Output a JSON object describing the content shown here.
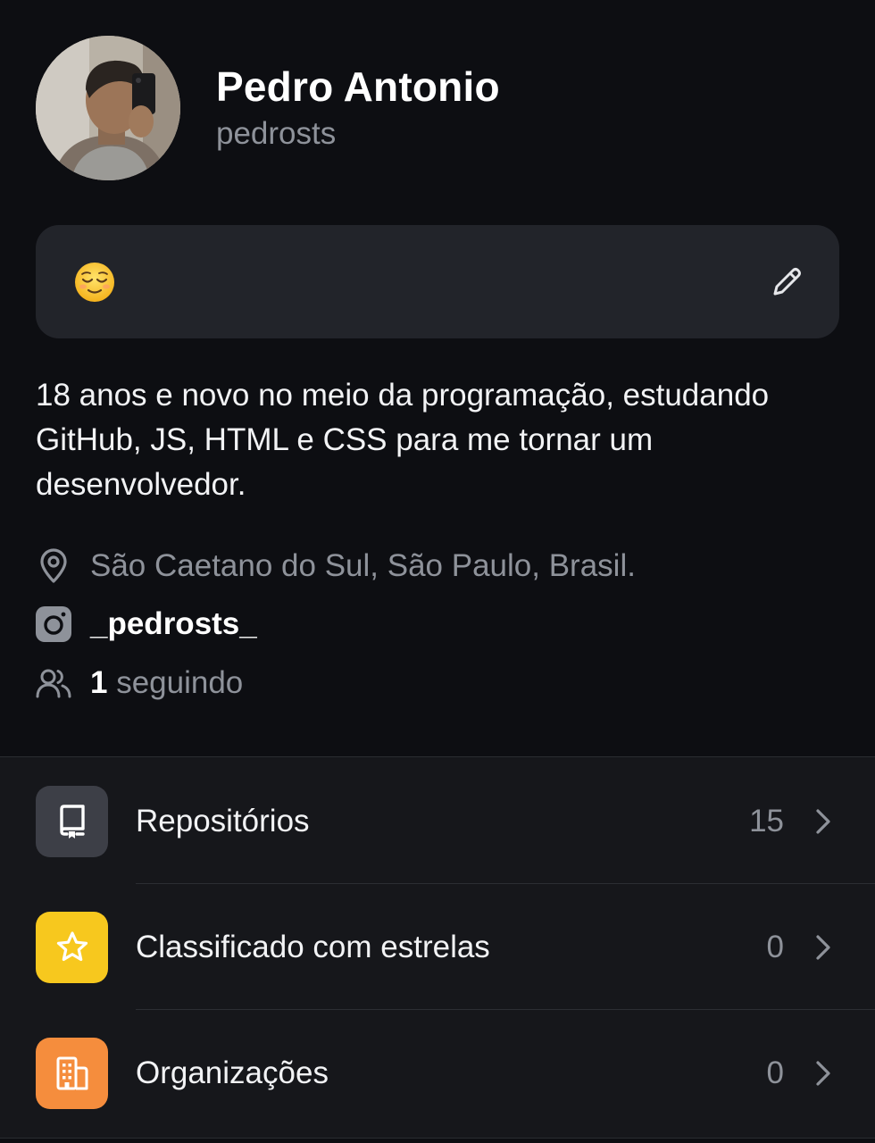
{
  "profile": {
    "display_name": "Pedro Antonio",
    "username": "pedrosts"
  },
  "status": {
    "emoji_icon": "relieved-face-emoji",
    "edit_icon": "pencil-icon"
  },
  "bio": "18 anos e novo no meio da programação, estudando GitHub, JS, HTML e CSS para me tornar um desenvolvedor.",
  "info": {
    "location": {
      "icon": "location-pin-icon",
      "text": "São Caetano do Sul, São Paulo, Brasil."
    },
    "instagram": {
      "icon": "instagram-icon",
      "text": "_pedrosts_"
    },
    "following": {
      "icon": "people-icon",
      "count": "1",
      "label": " seguindo"
    }
  },
  "list": [
    {
      "label": "Repositórios",
      "value": "15",
      "icon": "repo-icon",
      "color": "#3d3f47"
    },
    {
      "label": "Classificado com estrelas",
      "value": "0",
      "icon": "star-icon",
      "color": "#f7c81e"
    },
    {
      "label": "Organizações",
      "value": "0",
      "icon": "organization-icon",
      "color": "#f58d3d"
    }
  ],
  "colors": {
    "background": "#0d0e12",
    "card": "#22242a",
    "list_background": "#16171b",
    "muted_text": "#8e929a"
  }
}
